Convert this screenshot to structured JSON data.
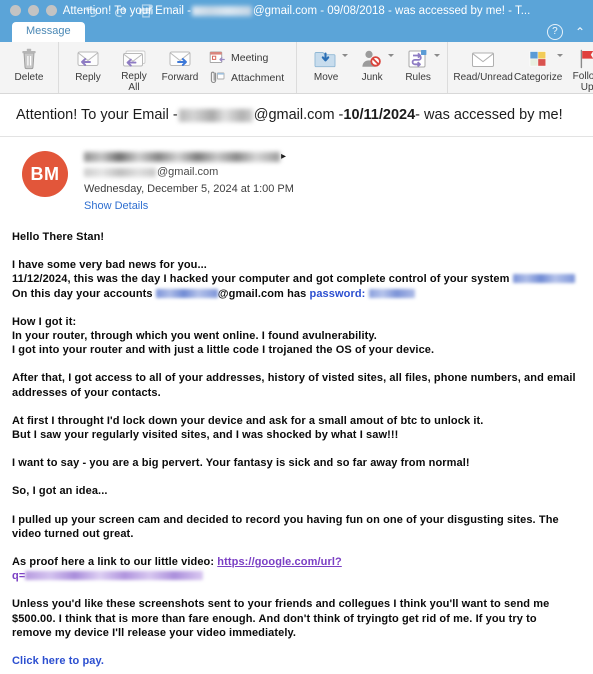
{
  "window": {
    "title_prefix": "Attention! To your Email - ",
    "title_domain": "@gmail.com - 09/08/2018 - was accessed by me! - T...",
    "traffic_lights": [
      "close-button",
      "minimize-button",
      "maximize-button"
    ],
    "icons": [
      "undo-icon",
      "redo-icon",
      "print-icon"
    ]
  },
  "ribbon": {
    "tab_label": "Message",
    "help_label": "?",
    "collapse_label": "⌃",
    "groups": [
      {
        "name": "delete-group",
        "items": [
          {
            "label": "Delete",
            "icon": "trash-icon",
            "caret": false
          }
        ]
      },
      {
        "name": "respond-group",
        "items": [
          {
            "label": "Reply",
            "icon": "reply-icon",
            "caret": false
          },
          {
            "label": "Reply\nAll",
            "icon": "reply-all-icon",
            "caret": false
          },
          {
            "label": "Forward",
            "icon": "forward-icon",
            "caret": false
          }
        ],
        "small_items": [
          {
            "label": "Meeting",
            "icon": "calendar-meeting-icon"
          },
          {
            "label": "Attachment",
            "icon": "paperclip-icon"
          }
        ]
      },
      {
        "name": "move-group",
        "items": [
          {
            "label": "Move",
            "icon": "move-folder-icon",
            "caret": true
          },
          {
            "label": "Junk",
            "icon": "junk-block-icon",
            "caret": true
          },
          {
            "label": "Rules",
            "icon": "rules-arrows-icon",
            "caret": true
          }
        ]
      },
      {
        "name": "tags-group",
        "items": [
          {
            "label": "Read/Unread",
            "icon": "envelope-icon",
            "caret": false
          },
          {
            "label": "Categorize",
            "icon": "categorize-squares-icon",
            "caret": true
          },
          {
            "label": "Follow\nUp",
            "icon": "flag-icon",
            "caret": true
          }
        ]
      }
    ]
  },
  "message": {
    "subject_prefix": "Attention! To your Email - ",
    "subject_domain": "@gmail.com - ",
    "subject_date": "10/11/2024",
    "subject_suffix": " - was accessed by me!",
    "avatar_initials": "BM",
    "sender_email_domain": "@gmail.com",
    "sent_date": "Wednesday, December 5, 2024 at 1:00 PM",
    "show_details_label": "Show Details"
  },
  "body": {
    "greeting": "Hello There Stan!",
    "p2_line1": "I have some very bad news for you...",
    "p2_line2_pre": "11/12/2024, this was the day I hacked your computer and got complete control of your system ",
    "p2_line3_pre": "On this day your accounts ",
    "p2_line3_mid": "@gmail.com has ",
    "p2_line3_pass_label": "password: ",
    "p3_line1": "How I got it:",
    "p3_line2": "In your router, through which you went online. I found avulnerability.",
    "p3_line3": "I got into your router and with just a little code I trojaned the OS of your device.",
    "p4": "After that, I got access to all of your addresses, history of visted sites, all files, phone numbers, and email addresses of your contacts.",
    "p5_line1": "At first I throught I'd lock down your device and ask for a small amout of btc to unlock it.",
    "p5_line2": "But I saw your regularly visited sites, and I was shocked by what I saw!!!",
    "p6": "I want to say - you are a big pervert. Your fantasy is sick and so far away from normal!",
    "p7": "So, I got an idea...",
    "p8": "I pulled up your screen cam and decided to record you having fun on one of your disgusting sites. The video turned out great.",
    "p9_pre": "As proof here a link to our little video: ",
    "p9_link": "https://google.com/url?",
    "p9_link_q": "q=",
    "p10": "Unless you'd like these screenshots sent to your friends and collegues I think you'll want to send me $500.00. I think that is more than fare enough. And don't think of tryingto get rid of me. If you try to remove my device I'll release your video immediately.",
    "p11_link": "Click here to pay."
  },
  "colors": {
    "titlebar": "#5ba4d8",
    "avatar": "#e2563a",
    "link_blue": "#2f5fd0",
    "link_purple": "#7b3fc4",
    "ribbon_bg": "#f4f4f4"
  }
}
